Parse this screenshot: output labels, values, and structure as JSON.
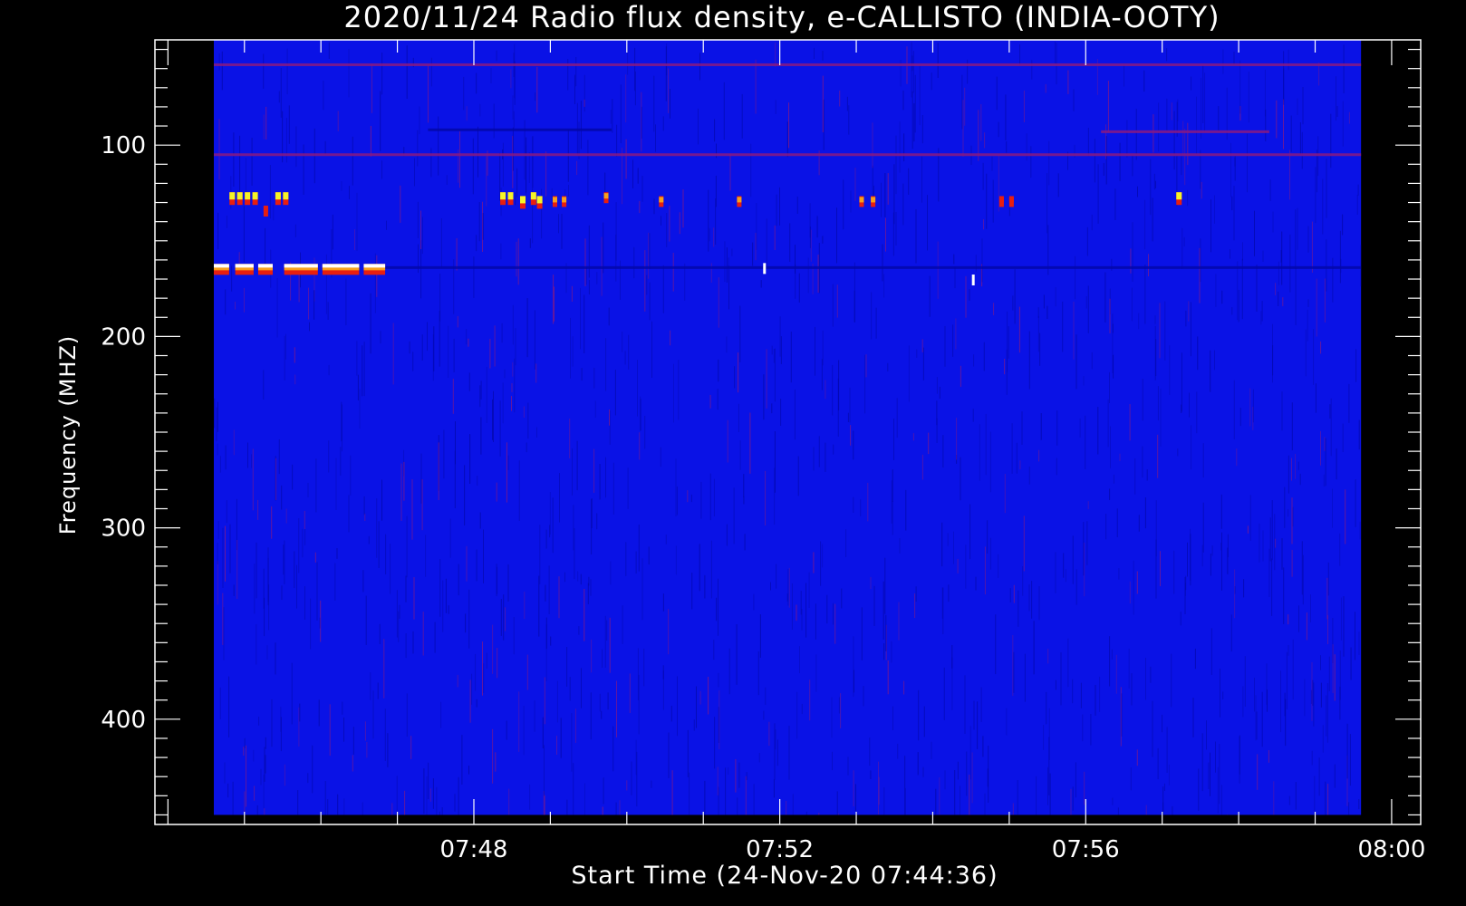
{
  "chart_data": {
    "type": "heatmap",
    "title": "2020/11/24  Radio flux density, e-CALLISTO (INDIA-OOTY)",
    "xlabel": "Start Time (24-Nov-20 07:44:36)",
    "ylabel": "Frequency (MHZ)",
    "x_ticks": [
      {
        "label": "07:48",
        "minutes": 3.4
      },
      {
        "label": "07:52",
        "minutes": 7.4
      },
      {
        "label": "07:56",
        "minutes": 11.4
      },
      {
        "label": "08:00",
        "minutes": 15.4
      }
    ],
    "xlim_minutes": [
      -0.77,
      15.78
    ],
    "y_ticks": [
      100,
      200,
      300,
      400
    ],
    "ylim": [
      45,
      455
    ],
    "data_extent": {
      "x_minutes": [
        0,
        15.0
      ],
      "y": [
        45,
        450
      ]
    },
    "colors": {
      "background": "#0a12e6",
      "noise_dark": "#0408a8",
      "noise_red": "#8a1a80",
      "burst_red": "#e81e10",
      "burst_orange": "#f7a01c",
      "burst_yellow": "#f5f528",
      "burst_white": "#ffffff"
    },
    "bands": [
      {
        "freq": 58,
        "kind": "noise-red",
        "x_minutes": [
          0,
          15.0
        ]
      },
      {
        "freq": 92,
        "kind": "noise-dark",
        "x_minutes": [
          2.8,
          5.2
        ]
      },
      {
        "freq": 93,
        "kind": "noise-red",
        "x_minutes": [
          11.6,
          13.8
        ]
      },
      {
        "freq": 105,
        "kind": "noise-red",
        "x_minutes": [
          0,
          15.0
        ]
      },
      {
        "freq": 164,
        "kind": "noise-dark",
        "x_minutes": [
          2.2,
          15.0
        ]
      }
    ],
    "bursts": [
      {
        "t": 0.24,
        "freq": 127,
        "level": "yellow"
      },
      {
        "t": 0.34,
        "freq": 127,
        "level": "yellow"
      },
      {
        "t": 0.44,
        "freq": 127,
        "level": "yellow"
      },
      {
        "t": 0.54,
        "freq": 127,
        "level": "yellow"
      },
      {
        "t": 0.68,
        "freq": 134,
        "level": "red"
      },
      {
        "t": 0.84,
        "freq": 127,
        "level": "yellow"
      },
      {
        "t": 0.94,
        "freq": 127,
        "level": "yellow"
      },
      {
        "t": 3.78,
        "freq": 127,
        "level": "yellow"
      },
      {
        "t": 3.88,
        "freq": 127,
        "level": "yellow"
      },
      {
        "t": 4.04,
        "freq": 129,
        "level": "yellow"
      },
      {
        "t": 4.18,
        "freq": 127,
        "level": "yellow"
      },
      {
        "t": 4.26,
        "freq": 129,
        "level": "yellow"
      },
      {
        "t": 4.46,
        "freq": 129,
        "level": "orange"
      },
      {
        "t": 4.58,
        "freq": 129,
        "level": "orange"
      },
      {
        "t": 5.13,
        "freq": 127,
        "level": "orange"
      },
      {
        "t": 5.85,
        "freq": 129,
        "level": "orange"
      },
      {
        "t": 6.87,
        "freq": 129,
        "level": "orange"
      },
      {
        "t": 8.47,
        "freq": 129,
        "level": "orange"
      },
      {
        "t": 8.62,
        "freq": 129,
        "level": "orange"
      },
      {
        "t": 10.3,
        "freq": 129,
        "level": "red"
      },
      {
        "t": 10.43,
        "freq": 129,
        "level": "red"
      },
      {
        "t": 12.62,
        "freq": 127,
        "level": "yellow"
      },
      {
        "t": 7.2,
        "freq": 164,
        "level": "white"
      },
      {
        "t": 9.93,
        "freq": 170,
        "level": "white"
      }
    ],
    "strong_band": {
      "freq": 164,
      "segments": [
        [
          0.0,
          0.2
        ],
        [
          0.28,
          0.52
        ],
        [
          0.58,
          0.77
        ],
        [
          0.92,
          1.36
        ],
        [
          1.42,
          1.9
        ],
        [
          1.96,
          2.24
        ]
      ]
    },
    "grid": false,
    "legend": "none"
  }
}
